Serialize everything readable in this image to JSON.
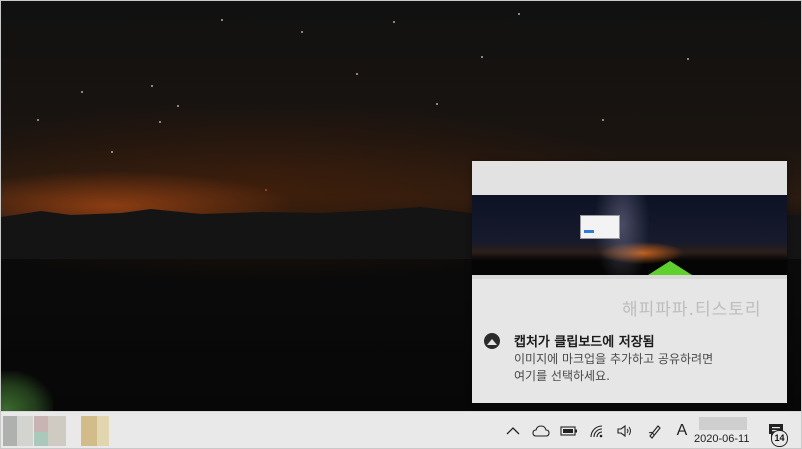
{
  "toast": {
    "watermark": "해피파파.티스토리",
    "title": "캡처가 클립보드에 저장됨",
    "line1": "이미지에 마크업을 추가하고 공유하려면",
    "line2": "여기를 선택하세요.",
    "icon": "snip-sketch-icon"
  },
  "taskbar": {
    "ime_label": "A",
    "date": "2020-06-11",
    "notification_count": "14",
    "tray_icons": [
      "chevron-up-icon",
      "onedrive-icon",
      "battery-icon",
      "wifi-icon",
      "volume-icon",
      "pen-icon",
      "ime-icon",
      "action-center-icon"
    ]
  },
  "colors": {
    "tent_green": "#5fd02c",
    "horizon_glow": "#a84814"
  }
}
